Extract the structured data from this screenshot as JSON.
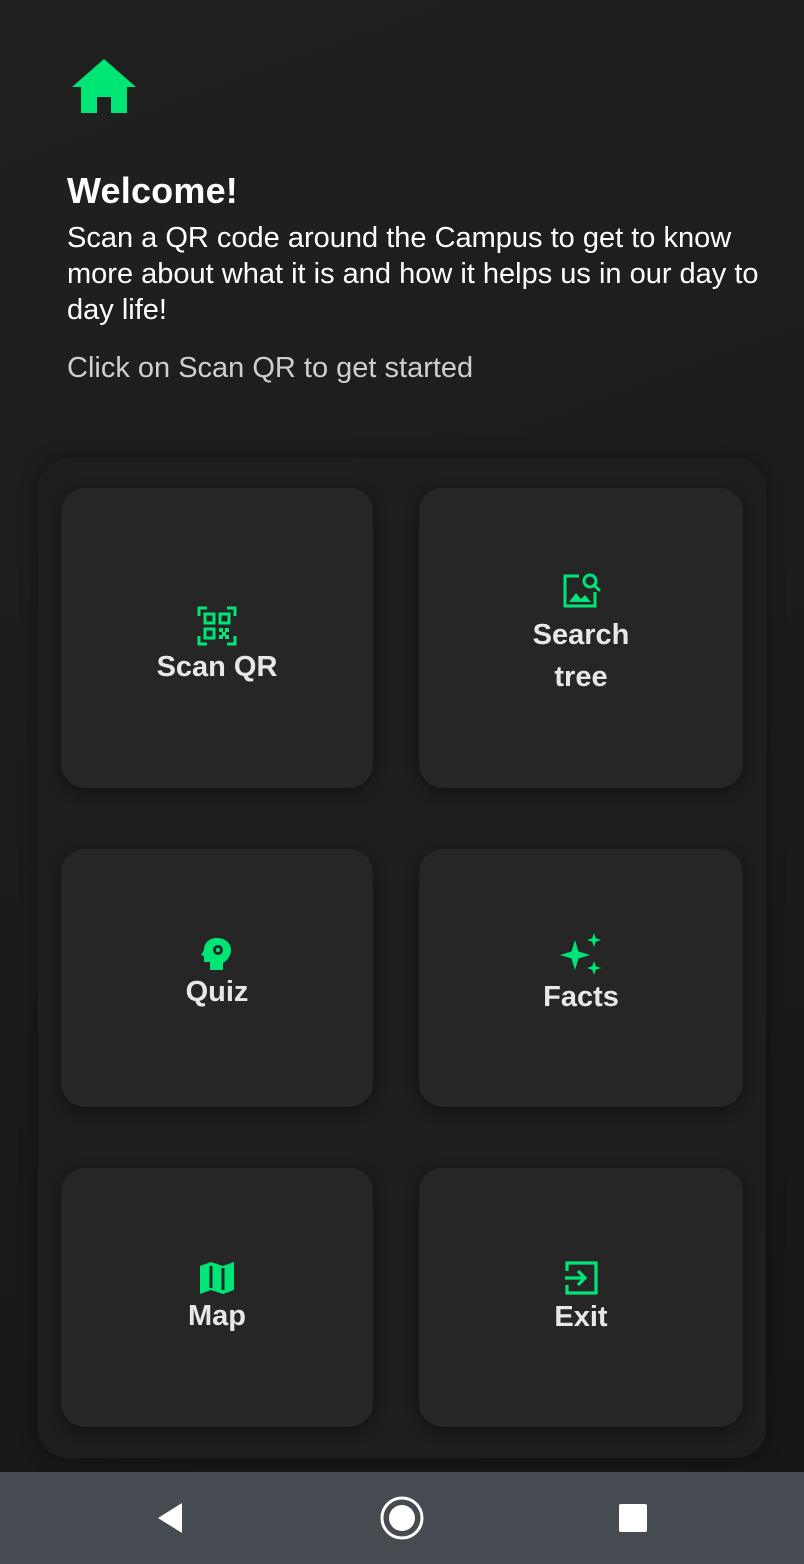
{
  "app": {
    "accent_color": "#00e676",
    "home_icon": "home-icon"
  },
  "welcome": {
    "title": "Welcome!",
    "body": "Scan a QR code around the Campus to get to know more about what it is and how it helps us in our day to day life!",
    "hint": "Click on Scan QR to get started"
  },
  "menu": {
    "scan": {
      "label": "Scan QR",
      "icon": "qr-scan-icon"
    },
    "search_line1": "Search",
    "search_line2": "tree",
    "search_icon": "image-search-icon",
    "quiz": {
      "label": "Quiz",
      "icon": "psychology-head-icon"
    },
    "facts": {
      "label": "Facts",
      "icon": "sparkle-icon"
    },
    "map": {
      "label": "Map",
      "icon": "map-icon"
    },
    "exit": {
      "label": "Exit",
      "icon": "exit-icon"
    }
  },
  "navbar": {
    "back_icon": "back-triangle-icon",
    "home_icon": "home-circle-icon",
    "recents_icon": "recents-square-icon"
  }
}
